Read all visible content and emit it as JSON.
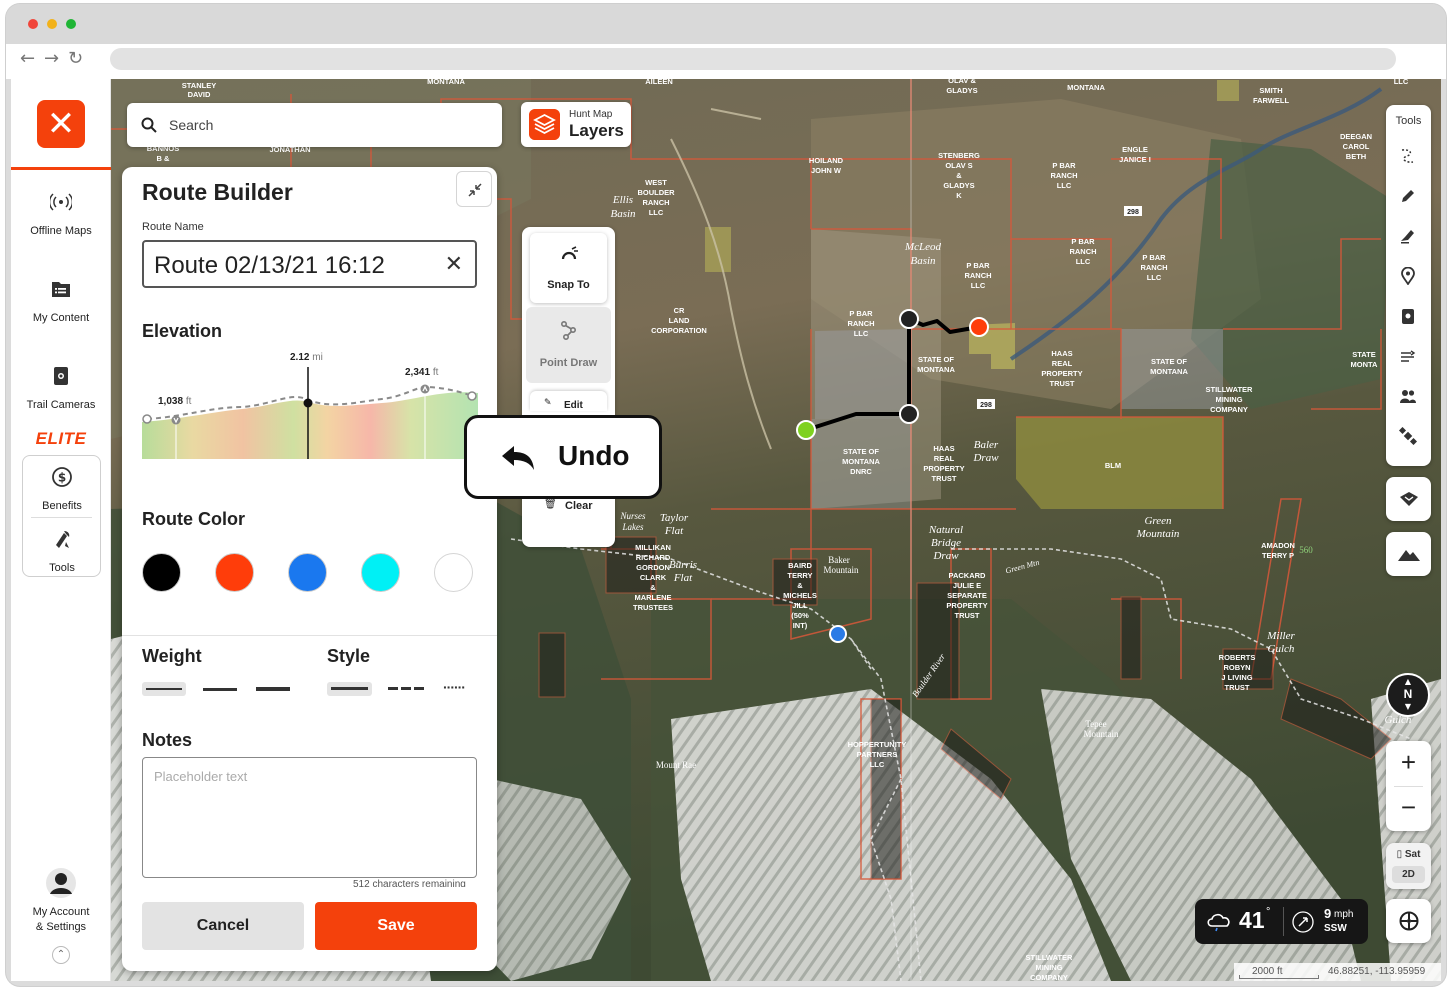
{
  "app": {
    "nav": {
      "offline_maps": "Offline Maps",
      "my_content": "My Content",
      "trail_cameras": "Trail Cameras",
      "elite": "ELITE",
      "benefits": "Benefits",
      "tools": "Tools",
      "account_line1": "My Account",
      "account_line2": "& Settings"
    },
    "search": {
      "placeholder": "Search"
    },
    "layers": {
      "small": "Hunt Map",
      "big": "Layers"
    },
    "route_builder": {
      "title": "Route Builder",
      "route_name_label": "Route Name",
      "route_name_value": "Route 02/13/21 16:12",
      "elevation_title": "Elevation",
      "elevation": {
        "min_value": "1,038",
        "min_unit": "ft",
        "marker_value": "2.12",
        "marker_unit": "mi",
        "max_value": "2,341",
        "max_unit": "ft"
      },
      "route_color_title": "Route Color",
      "colors": [
        "#000000",
        "#ff3d0a",
        "#1a78ef",
        "#00f0f5",
        "#ffffff"
      ],
      "weight_title": "Weight",
      "style_title": "Style",
      "notes_title": "Notes",
      "notes_placeholder": "Placeholder text",
      "chars_remaining": "512 characters remaining",
      "cancel": "Cancel",
      "save": "Save"
    },
    "draw_tools": {
      "snap_to": "Snap To",
      "point_draw": "Point Draw",
      "edit": "Edit",
      "clear": "Clear",
      "undo": "Undo"
    },
    "right_tools": {
      "title": "Tools"
    },
    "map_mode": {
      "type": "Sat",
      "dim": "2D"
    },
    "compass": "N",
    "weather": {
      "temp": "41",
      "deg": "°",
      "wind_speed": "9",
      "wind_unit": "mph",
      "wind_dir": "SSW"
    },
    "scale": {
      "distance": "2000 ft",
      "coords": "46.88251, -113.95959"
    },
    "map_labels": [
      {
        "t": "STANLEY"
      },
      {
        "t": "DAVID"
      },
      {
        "t": "MONTANA"
      },
      {
        "t": "AILEEN"
      },
      {
        "t": "OLAV &"
      },
      {
        "t": "GLADYS"
      },
      {
        "t": "SMITH"
      },
      {
        "t": "FARWELL"
      },
      {
        "t": "DEEGAN"
      },
      {
        "t": "CAROL"
      },
      {
        "t": "BETH"
      },
      {
        "t": "HOILAND"
      },
      {
        "t": "JOHN W"
      },
      {
        "t": "STENBERG"
      },
      {
        "t": "OLAV S"
      },
      {
        "t": "GLADYS K"
      },
      {
        "t": "P BAR RANCH LLC"
      },
      {
        "t": "ENGLE JANICE I"
      },
      {
        "t": "WEST BOULDER RANCH LLC"
      },
      {
        "t": "Ellis Basin"
      },
      {
        "t": "McLeod Basin"
      },
      {
        "t": "CR LAND CORPORATION"
      },
      {
        "t": "STATE OF MONTANA"
      },
      {
        "t": "HAAS REAL PROPERTY TRUST"
      },
      {
        "t": "STILLWATER MINING COMPANY"
      },
      {
        "t": "STATE OF MONTANA DNRC"
      },
      {
        "t": "Baler Draw"
      },
      {
        "t": "BLM"
      },
      {
        "t": "Green Mountain"
      },
      {
        "t": "AMADON TERRY P"
      },
      {
        "t": "560"
      },
      {
        "t": "Taylor Flat"
      },
      {
        "t": "Nurses Lakes"
      },
      {
        "t": "MILLIKAN RICHARD GORDON CLARK & MARLENE TRUSTEES"
      },
      {
        "t": "Burris Flat"
      },
      {
        "t": "BAIRD TERRY & MICHELS JILL (50% INT)"
      },
      {
        "t": "Baker Mountain"
      },
      {
        "t": "Natural Bridge Draw"
      },
      {
        "t": "PACKARD JULIE E SEPARATE PROPERTY TRUST"
      },
      {
        "t": "Green Mtn"
      },
      {
        "t": "Boulder River"
      },
      {
        "t": "ROBERTS ROBYN J LIVING TRUST"
      },
      {
        "t": "Miller Gulch"
      },
      {
        "t": "HOPPERTUNITY PARTNERS LLC"
      },
      {
        "t": "Tepee Mountain"
      },
      {
        "t": "Mount Rae"
      },
      {
        "t": "STILLWATER MINING COMPANY"
      },
      {
        "t": "JONATHAN"
      },
      {
        "t": "BANNOS B &"
      },
      {
        "t": "298"
      },
      {
        "t": "LLC"
      }
    ]
  }
}
